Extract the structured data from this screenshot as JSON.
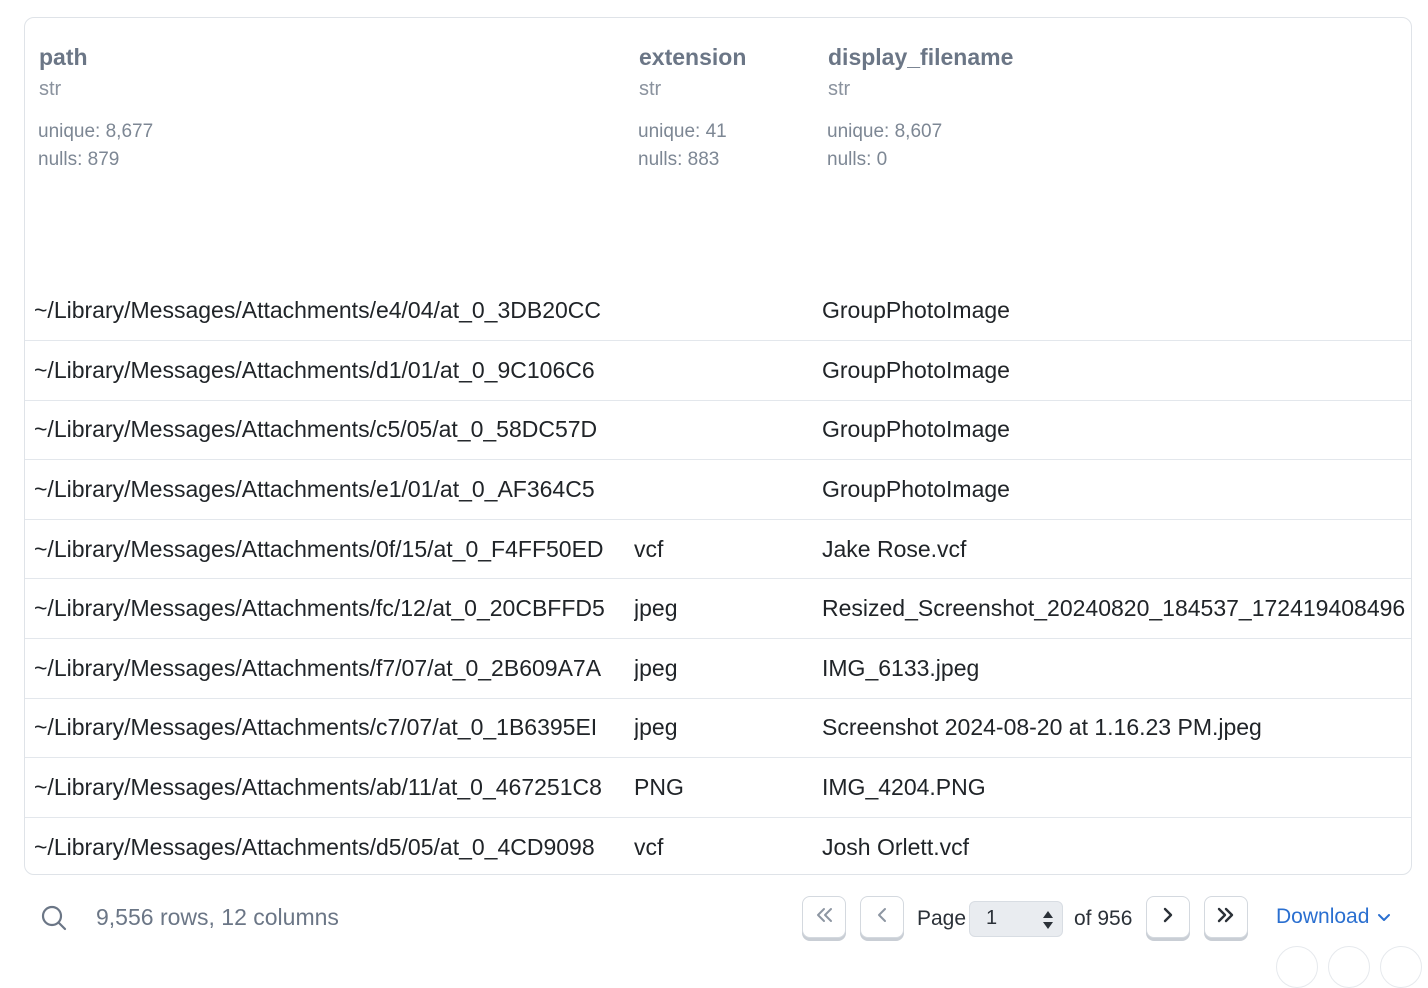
{
  "columns": [
    {
      "name": "path",
      "type": "str",
      "unique": "unique: 8,677",
      "nulls": "nulls: 879"
    },
    {
      "name": "extension",
      "type": "str",
      "unique": "unique: 41",
      "nulls": "nulls: 883"
    },
    {
      "name": "display_filename",
      "type": "str",
      "unique": "unique: 8,607",
      "nulls": "nulls: 0"
    }
  ],
  "rows": [
    {
      "path": "~/Library/Messages/Attachments/e4/04/at_0_3DB20CC",
      "extension": "",
      "display_filename": "GroupPhotoImage"
    },
    {
      "path": "~/Library/Messages/Attachments/d1/01/at_0_9C106C6",
      "extension": "",
      "display_filename": "GroupPhotoImage"
    },
    {
      "path": "~/Library/Messages/Attachments/c5/05/at_0_58DC57D",
      "extension": "",
      "display_filename": "GroupPhotoImage"
    },
    {
      "path": "~/Library/Messages/Attachments/e1/01/at_0_AF364C5",
      "extension": "",
      "display_filename": "GroupPhotoImage"
    },
    {
      "path": "~/Library/Messages/Attachments/0f/15/at_0_F4FF50ED",
      "extension": "vcf",
      "display_filename": "Jake Rose.vcf"
    },
    {
      "path": "~/Library/Messages/Attachments/fc/12/at_0_20CBFFD5",
      "extension": "jpeg",
      "display_filename": "Resized_Screenshot_20240820_184537_172419408496"
    },
    {
      "path": "~/Library/Messages/Attachments/f7/07/at_0_2B609A7A",
      "extension": "jpeg",
      "display_filename": "IMG_6133.jpeg"
    },
    {
      "path": "~/Library/Messages/Attachments/c7/07/at_0_1B6395EI",
      "extension": "jpeg",
      "display_filename": "Screenshot 2024-08-20 at 1.16.23 PM.jpeg"
    },
    {
      "path": "~/Library/Messages/Attachments/ab/11/at_0_467251C8",
      "extension": "PNG",
      "display_filename": "IMG_4204.PNG"
    },
    {
      "path": "~/Library/Messages/Attachments/d5/05/at_0_4CD9098",
      "extension": "vcf",
      "display_filename": "Josh Orlett.vcf"
    }
  ],
  "footer": {
    "summary": "9,556 rows, 12 columns",
    "page_label": "Page",
    "page_value": "1",
    "of_label": "of 956",
    "download_label": "Download"
  },
  "icons": {
    "search": "search-icon",
    "first": "chevrons-left-icon",
    "prev": "chevron-left-icon",
    "next": "chevron-right-icon",
    "last": "chevrons-right-icon",
    "download_caret": "chevron-down-icon"
  },
  "colors": {
    "accent": "#2a6fd0",
    "header_text": "#6b7686",
    "border": "#dfe3e8"
  }
}
